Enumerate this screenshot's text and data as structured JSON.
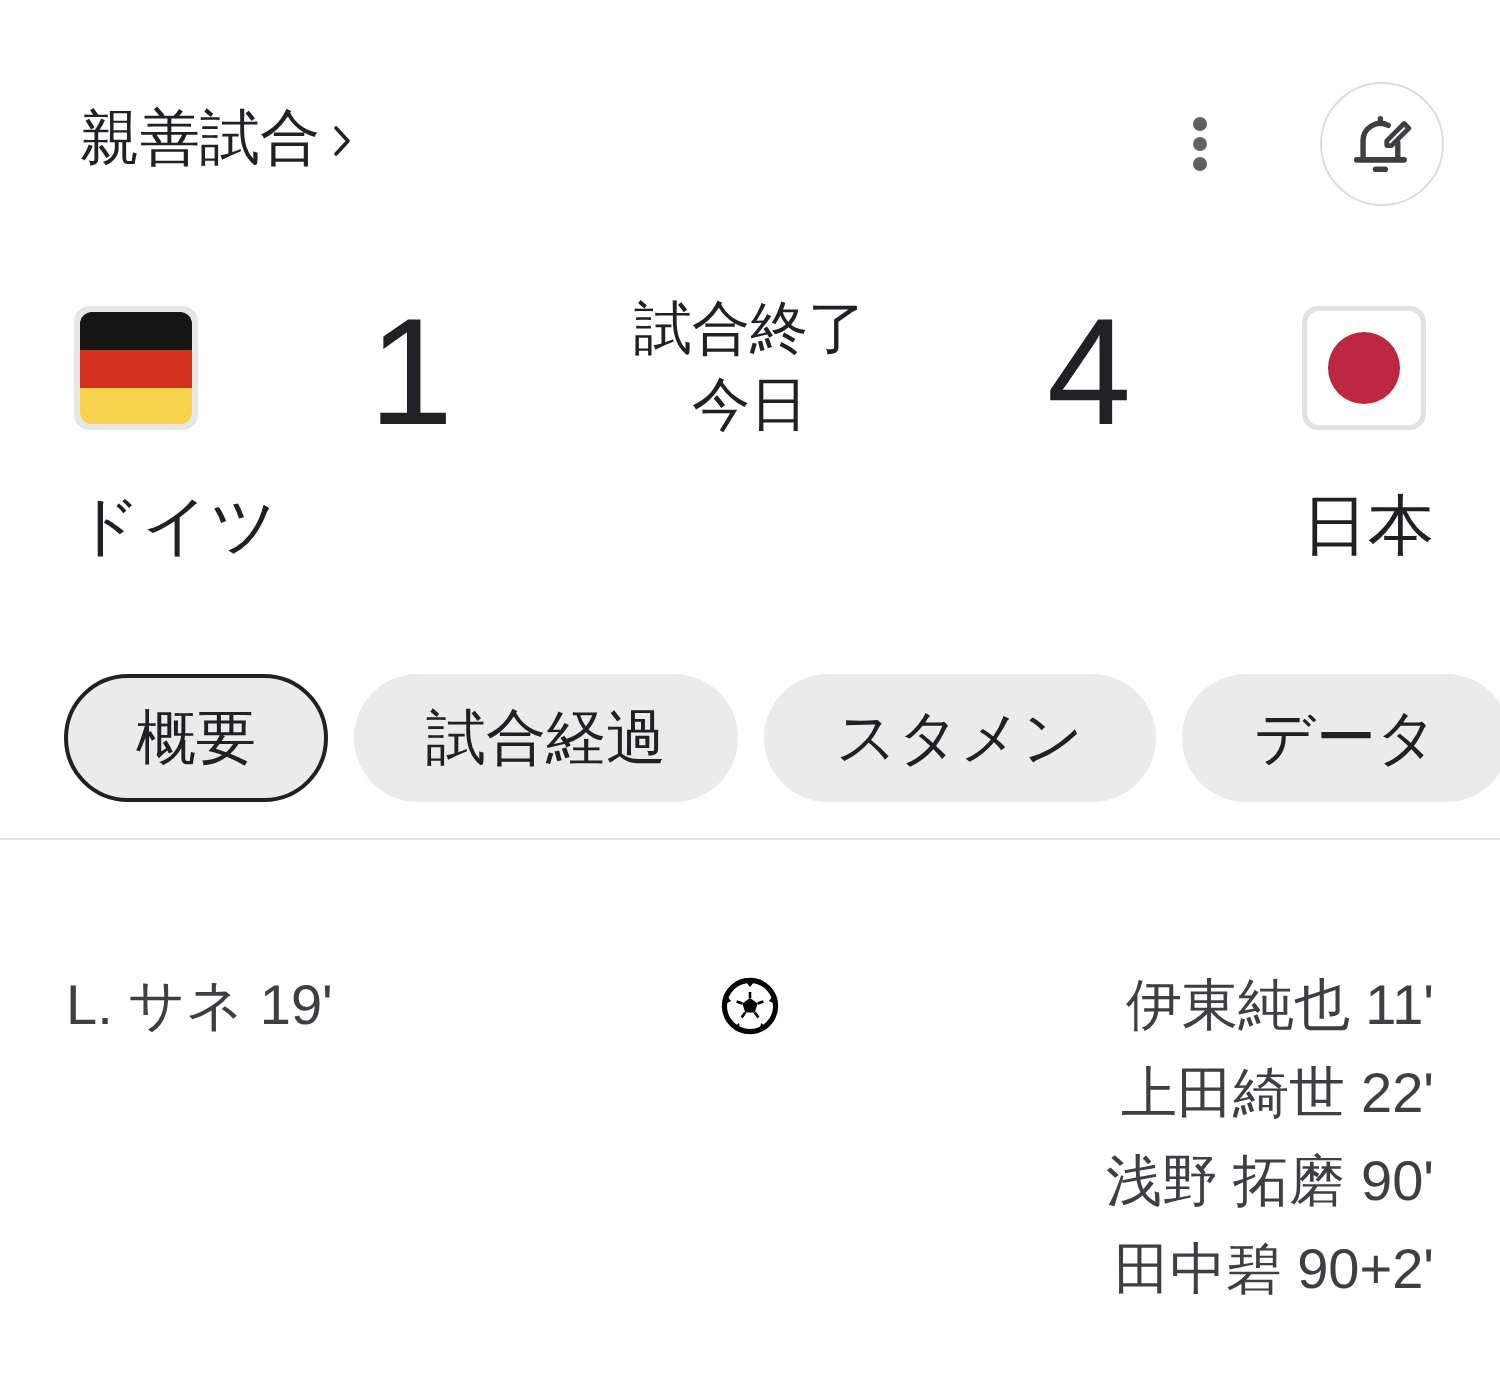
{
  "header": {
    "title": "親善試合"
  },
  "match": {
    "home": {
      "name": "ドイツ",
      "score": "1"
    },
    "status": "試合終了",
    "date": "今日",
    "away": {
      "name": "日本",
      "score": "4"
    }
  },
  "tabs": [
    {
      "label": "概要",
      "selected": true
    },
    {
      "label": "試合経過",
      "selected": false
    },
    {
      "label": "スタメン",
      "selected": false
    },
    {
      "label": "データ",
      "selected": false
    }
  ],
  "goals": {
    "home": [
      "L. サネ 19'"
    ],
    "away": [
      "伊東純也 11'",
      "上田綺世 22'",
      "浅野 拓磨 90'",
      "田中碧 90+2'"
    ]
  }
}
